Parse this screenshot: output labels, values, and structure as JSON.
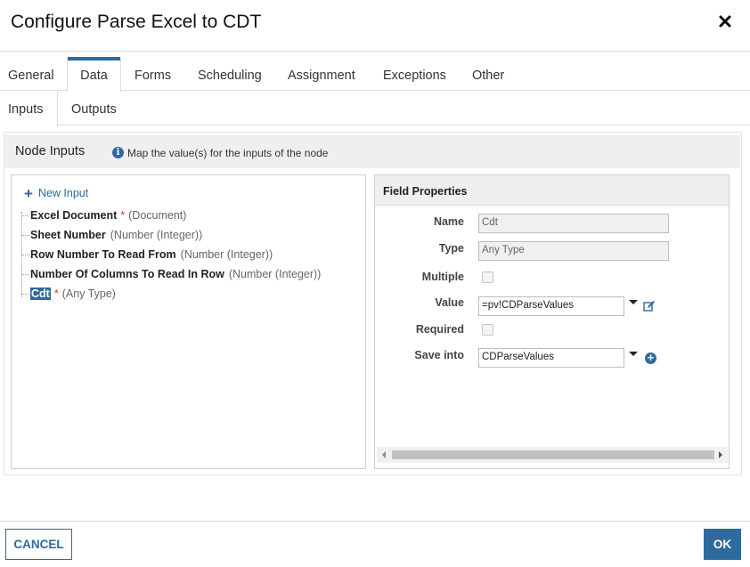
{
  "dialog": {
    "title": "Configure Parse Excel to CDT",
    "close_icon": "close-icon"
  },
  "tabs": [
    {
      "label": "General",
      "active": false
    },
    {
      "label": "Data",
      "active": true
    },
    {
      "label": "Forms",
      "active": false
    },
    {
      "label": "Scheduling",
      "active": false
    },
    {
      "label": "Assignment",
      "active": false
    },
    {
      "label": "Exceptions",
      "active": false
    },
    {
      "label": "Other",
      "active": false
    }
  ],
  "subtabs": [
    {
      "label": "Inputs",
      "active": true
    },
    {
      "label": "Outputs",
      "active": false
    }
  ],
  "node_inputs": {
    "title": "Node Inputs",
    "info_text": "Map the value(s) for the inputs of the node",
    "new_input_label": "New Input",
    "items": [
      {
        "name": "Excel Document",
        "required": "*",
        "type": "(Document)",
        "selected": false
      },
      {
        "name": "Sheet Number",
        "required": "",
        "type": "(Number (Integer))",
        "selected": false
      },
      {
        "name": "Row Number To Read From",
        "required": "",
        "type": "(Number (Integer))",
        "selected": false
      },
      {
        "name": "Number Of Columns To Read In Row",
        "required": "",
        "type": "(Number (Integer))",
        "selected": false
      },
      {
        "name": "Cdt",
        "required": "*",
        "type": "(Any Type)",
        "selected": true
      }
    ]
  },
  "field_properties": {
    "title": "Field Properties",
    "name_label": "Name",
    "name_value": "Cdt",
    "type_label": "Type",
    "type_value": "Any Type",
    "multiple_label": "Multiple",
    "multiple_checked": false,
    "value_label": "Value",
    "value_value": "=pv!CDParseValues",
    "required_label": "Required",
    "required_checked": false,
    "save_into_label": "Save into",
    "save_into_value": "CDParseValues"
  },
  "footer": {
    "cancel_label": "CANCEL",
    "ok_label": "OK"
  },
  "colors": {
    "accent": "#2f6a9d",
    "required": "#dd3333"
  }
}
